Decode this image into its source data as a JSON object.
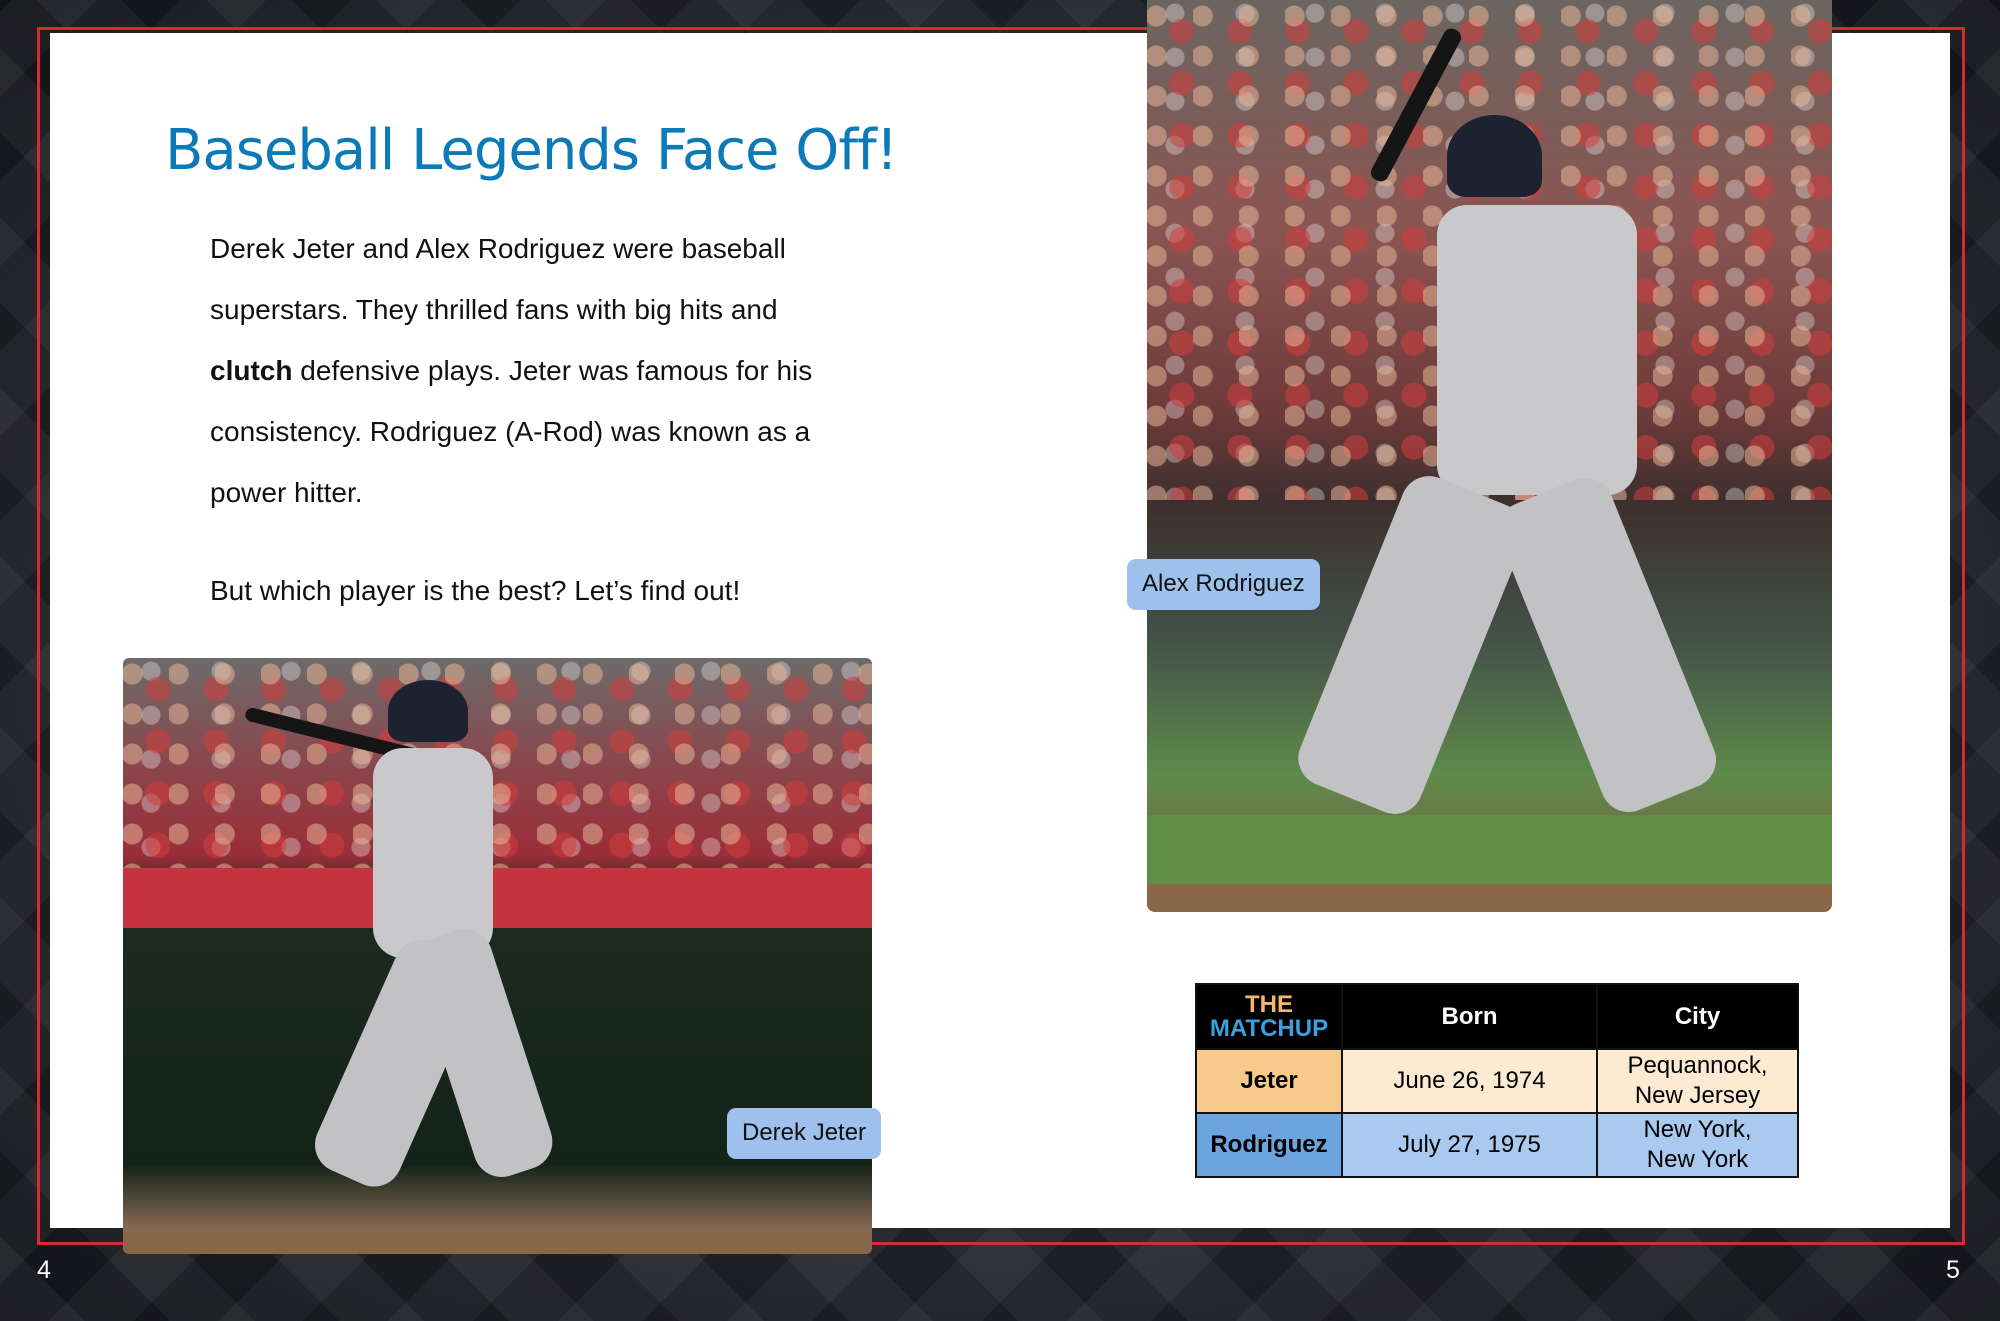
{
  "page": {
    "title": "Baseball Legends Face Off!",
    "left_page_number": "4",
    "right_page_number": "5"
  },
  "body": {
    "p1_a": "Derek Jeter and Alex Rodriguez were baseball superstars. They thrilled fans with big hits and ",
    "p1_bold": "clutch",
    "p1_b": " defensive plays. Jeter was famous for his consistency. Rodriguez (A-Rod) was known as a power hitter.",
    "p2": "But which player is the best? Let’s find out!"
  },
  "photos": {
    "jeter_caption": "Derek Jeter",
    "arod_caption": "Alex Rodriguez"
  },
  "matchup_table": {
    "logo_line1": "THE",
    "logo_line2": "MATCHUP",
    "headers": [
      "Born",
      "City"
    ],
    "rows": [
      {
        "name": "Jeter",
        "born": "June 26, 1974",
        "city_line1": "Pequannock,",
        "city_line2": "New Jersey"
      },
      {
        "name": "Rodriguez",
        "born": "July 27, 1975",
        "city_line1": "New York,",
        "city_line2": "New York"
      }
    ]
  },
  "colors": {
    "title_blue": "#0c7ab8",
    "frame_red": "#d52a2e",
    "caption_blue": "#9dc0ec",
    "jeter_tan": "#f7c98a",
    "rodriguez_blue": "#6ca4de"
  }
}
